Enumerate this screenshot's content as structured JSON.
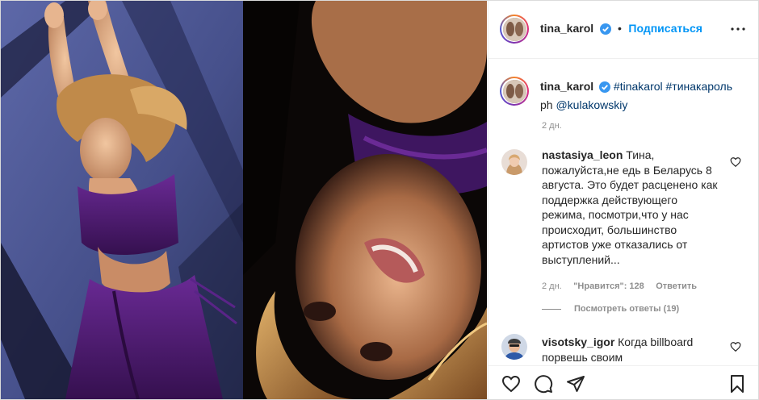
{
  "post": {
    "author": "tina_karol",
    "follow_label": "Подписаться",
    "separator": "•"
  },
  "caption": {
    "username": "tina_karol",
    "hashtag1": "#tinakarol",
    "hashtag2": "#тинакароль",
    "credit_prefix": "ph ",
    "credit_mention": "@kulakowskiy",
    "time": "2 дн."
  },
  "comments": [
    {
      "username": "nastasiya_leon",
      "line1": "Тина,",
      "line2": "пожалуйста,не едь в Беларусь 8",
      "line3": "августа. Это будет расценено как",
      "line4": "поддержка действующего",
      "line5": "режима, посмотри,что у нас",
      "line6": "происходит, большинство",
      "line7": "артистов уже отказались от",
      "line8": "выступлений...",
      "time": "2 дн.",
      "likes": "\"Нравится\": 128",
      "reply_label": "Ответить",
      "view_replies": "Посмотреть ответы (19)"
    },
    {
      "username": "visotsky_igor",
      "line1": "Когда billboard",
      "line2": "порвешь своим"
    }
  ],
  "icons": {
    "more": "more-options-icon",
    "verified": "verified-badge-icon",
    "like": "heart-icon",
    "comment": "comment-bubble-icon",
    "share": "paper-plane-icon",
    "save": "bookmark-icon"
  },
  "colors": {
    "accent": "#0095f6",
    "verified": "#3897f0",
    "hashtag": "#00376b",
    "muted": "#8e8e8e",
    "dress": "#4a1a6e",
    "wall": "#4b5590"
  }
}
